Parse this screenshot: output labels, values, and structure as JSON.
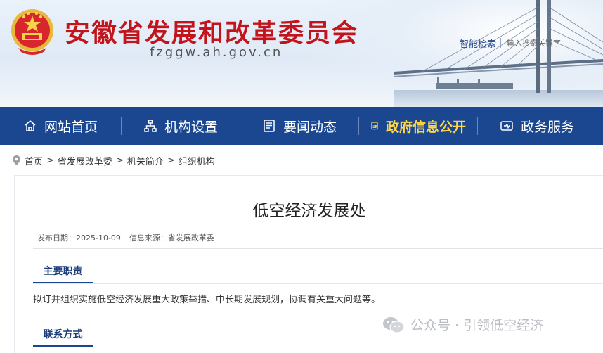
{
  "header": {
    "site_title": "安徽省发展和改革委员会",
    "site_domain": "fzggw.ah.gov.cn",
    "search_button": "智能检索",
    "search_placeholder": "输入搜索关键字"
  },
  "nav": {
    "items": [
      {
        "label": "网站首页",
        "icon": "home-icon"
      },
      {
        "label": "机构设置",
        "icon": "org-chart-icon"
      },
      {
        "label": "要闻动态",
        "icon": "news-icon"
      },
      {
        "label": "政府信息公开",
        "icon": "info-disclosure-icon",
        "active": true
      },
      {
        "label": "政务服务",
        "icon": "service-icon"
      }
    ]
  },
  "breadcrumb": {
    "items": [
      "首页",
      "省发展改革委",
      "机关简介",
      "组织机构"
    ],
    "separator": ">"
  },
  "article": {
    "title": "低空经济发展处",
    "publish_label": "发布日期：",
    "publish_date": "2025-10-09",
    "source_label": "信息来源：",
    "source": "省发展改革委",
    "section1_title": "主要职责",
    "section1_body": "拟订并组织实施低空经济发展重大政策举措、中长期发展规划，协调有关重大问题等。",
    "section2_title": "联系方式"
  },
  "watermark": {
    "text": "公众号 · 引领低空经济"
  },
  "colors": {
    "title_red": "#c4141b",
    "nav_blue": "#1b4790",
    "nav_active": "#ffd84a"
  }
}
